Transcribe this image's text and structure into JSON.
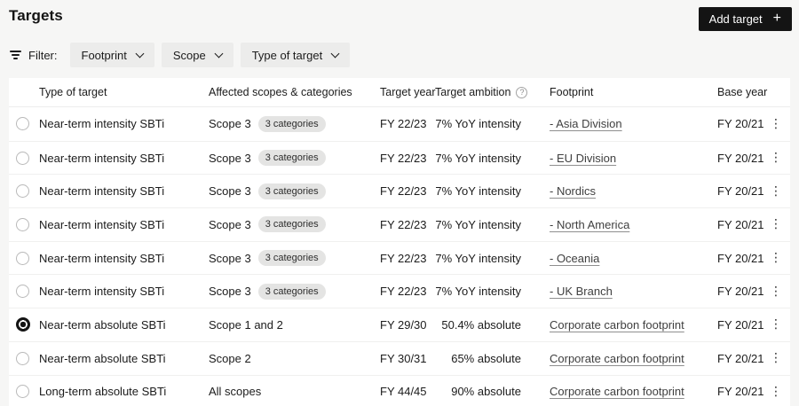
{
  "page": {
    "title": "Targets"
  },
  "toolbar": {
    "add_target_label": "Add target"
  },
  "filters": {
    "label": "Filter:",
    "chips": [
      {
        "label": "Footprint"
      },
      {
        "label": "Scope"
      },
      {
        "label": "Type of target"
      }
    ]
  },
  "table": {
    "headers": {
      "type": "Type of target",
      "scopes": "Affected scopes & categories",
      "target_year": "Target year",
      "target_ambition": "Target ambition",
      "footprint": "Footprint",
      "base_year": "Base year"
    },
    "rows": [
      {
        "selected": false,
        "type": "Near-term intensity SBTi",
        "scope": "Scope 3",
        "badge": "3 categories",
        "target_year": "FY 22/23",
        "ambition": "7% YoY intensity",
        "footprint": "- Asia Division",
        "base_year": "FY 20/21"
      },
      {
        "selected": false,
        "type": "Near-term intensity SBTi",
        "scope": "Scope 3",
        "badge": "3 categories",
        "target_year": "FY 22/23",
        "ambition": "7% YoY intensity",
        "footprint": "- EU Division",
        "base_year": "FY 20/21"
      },
      {
        "selected": false,
        "type": "Near-term intensity SBTi",
        "scope": "Scope 3",
        "badge": "3 categories",
        "target_year": "FY 22/23",
        "ambition": "7% YoY intensity",
        "footprint": "- Nordics",
        "base_year": "FY 20/21"
      },
      {
        "selected": false,
        "type": "Near-term intensity SBTi",
        "scope": "Scope 3",
        "badge": "3 categories",
        "target_year": "FY 22/23",
        "ambition": "7% YoY intensity",
        "footprint": "- North America",
        "base_year": "FY 20/21"
      },
      {
        "selected": false,
        "type": "Near-term intensity SBTi",
        "scope": "Scope 3",
        "badge": "3 categories",
        "target_year": "FY 22/23",
        "ambition": "7% YoY intensity",
        "footprint": "- Oceania",
        "base_year": "FY 20/21"
      },
      {
        "selected": false,
        "type": "Near-term intensity SBTi",
        "scope": "Scope 3",
        "badge": "3 categories",
        "target_year": "FY 22/23",
        "ambition": "7% YoY intensity",
        "footprint": "- UK Branch",
        "base_year": "FY 20/21"
      },
      {
        "selected": true,
        "type": "Near-term absolute SBTi",
        "scope": "Scope 1 and 2",
        "badge": null,
        "target_year": "FY 29/30",
        "ambition": "50.4% absolute",
        "footprint": "Corporate carbon footprint",
        "base_year": "FY 20/21"
      },
      {
        "selected": false,
        "type": "Near-term absolute SBTi",
        "scope": "Scope 2",
        "badge": null,
        "target_year": "FY 30/31",
        "ambition": "65% absolute",
        "footprint": "Corporate carbon footprint",
        "base_year": "FY 20/21"
      },
      {
        "selected": false,
        "type": "Long-term absolute SBTi",
        "scope": "All scopes",
        "badge": null,
        "target_year": "FY 44/45",
        "ambition": "90% absolute",
        "footprint": "Corporate carbon footprint",
        "base_year": "FY 20/21"
      }
    ]
  },
  "icons": {
    "plus": "+",
    "help": "?",
    "kebab": "⋮"
  },
  "colors": {
    "accent": "#141414",
    "page_bg": "#f6f6f5",
    "card_bg": "#ffffff",
    "badge_bg": "#e4e4e3"
  }
}
